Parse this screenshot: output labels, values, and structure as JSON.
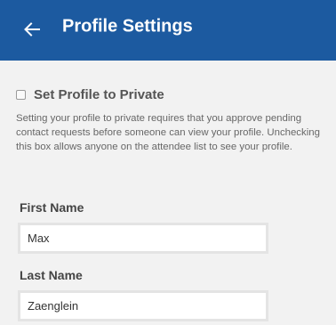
{
  "header": {
    "back_icon": "arrow-left-icon",
    "title": "Profile Settings",
    "background_color": "#1c5aa0"
  },
  "privacy": {
    "label": "Set Profile to Private",
    "checked": false,
    "description": "Setting your profile to private requires that you approve pending contact requests before someone can view your profile. Unchecking this box allows anyone on the attendee list to see your profile."
  },
  "first_name": {
    "label": "First Name",
    "value": "Max"
  },
  "last_name": {
    "label": "Last Name",
    "value": "Zaenglein"
  }
}
